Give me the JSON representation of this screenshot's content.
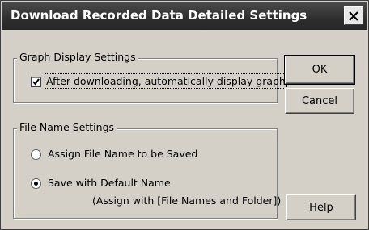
{
  "dialog": {
    "title": "Download Recorded Data Detailed Settings",
    "close_icon": "close-icon"
  },
  "graph_group": {
    "label": "Graph Display Settings",
    "auto_display": {
      "label": "After downloading, automatically display graph",
      "checked": true
    }
  },
  "file_group": {
    "label": "File Name Settings",
    "options": [
      {
        "label": "Assign File Name to be Saved",
        "selected": false
      },
      {
        "label": "Save with Default Name",
        "selected": true
      }
    ],
    "note": "(Assign with [File Names and Folder])"
  },
  "buttons": {
    "ok": "OK",
    "cancel": "Cancel",
    "help": "Help"
  }
}
